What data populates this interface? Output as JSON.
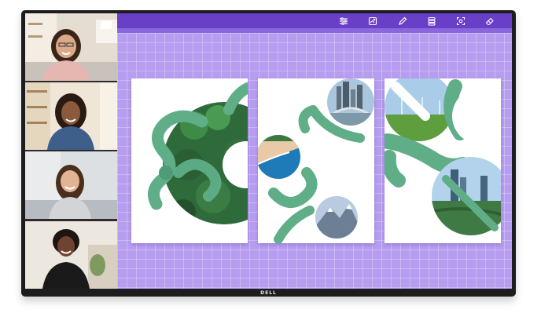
{
  "device": {
    "brand": "DELL"
  },
  "toolbar": {
    "tools": [
      {
        "icon": "sliders-icon"
      },
      {
        "icon": "image-edit-icon"
      },
      {
        "icon": "pen-icon"
      },
      {
        "icon": "layers-icon"
      },
      {
        "icon": "focus-frame-icon"
      },
      {
        "icon": "eraser-icon"
      }
    ]
  },
  "participants": [
    {
      "name": ""
    },
    {
      "name": ""
    },
    {
      "name": ""
    },
    {
      "name": ""
    }
  ],
  "colors": {
    "toolbar": "#6a3fc7",
    "canvas": "#b69df0",
    "accent_green": "#5fae88"
  }
}
